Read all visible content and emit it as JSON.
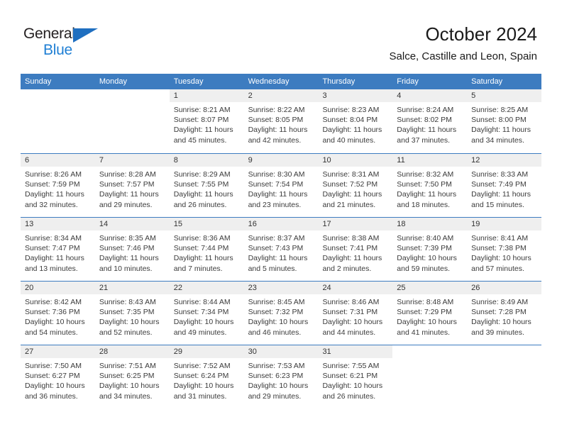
{
  "brand": {
    "name_top": "General",
    "name_bottom": "Blue",
    "color_dark": "#231f20",
    "color_blue": "#1f7fd4"
  },
  "header": {
    "title": "October 2024",
    "subtitle": "Salce, Castille and Leon, Spain"
  },
  "theme": {
    "header_row_bg": "#3d7cc0",
    "daynum_band_bg": "#efefef",
    "text": "#3b3b3b"
  },
  "calendar": {
    "weekdays": [
      "Sunday",
      "Monday",
      "Tuesday",
      "Wednesday",
      "Thursday",
      "Friday",
      "Saturday"
    ],
    "weeks": [
      [
        {
          "day": "",
          "sunrise": "",
          "sunset": "",
          "daylight": ""
        },
        {
          "day": "",
          "sunrise": "",
          "sunset": "",
          "daylight": ""
        },
        {
          "day": "1",
          "sunrise": "Sunrise: 8:21 AM",
          "sunset": "Sunset: 8:07 PM",
          "daylight": "Daylight: 11 hours and 45 minutes."
        },
        {
          "day": "2",
          "sunrise": "Sunrise: 8:22 AM",
          "sunset": "Sunset: 8:05 PM",
          "daylight": "Daylight: 11 hours and 42 minutes."
        },
        {
          "day": "3",
          "sunrise": "Sunrise: 8:23 AM",
          "sunset": "Sunset: 8:04 PM",
          "daylight": "Daylight: 11 hours and 40 minutes."
        },
        {
          "day": "4",
          "sunrise": "Sunrise: 8:24 AM",
          "sunset": "Sunset: 8:02 PM",
          "daylight": "Daylight: 11 hours and 37 minutes."
        },
        {
          "day": "5",
          "sunrise": "Sunrise: 8:25 AM",
          "sunset": "Sunset: 8:00 PM",
          "daylight": "Daylight: 11 hours and 34 minutes."
        }
      ],
      [
        {
          "day": "6",
          "sunrise": "Sunrise: 8:26 AM",
          "sunset": "Sunset: 7:59 PM",
          "daylight": "Daylight: 11 hours and 32 minutes."
        },
        {
          "day": "7",
          "sunrise": "Sunrise: 8:28 AM",
          "sunset": "Sunset: 7:57 PM",
          "daylight": "Daylight: 11 hours and 29 minutes."
        },
        {
          "day": "8",
          "sunrise": "Sunrise: 8:29 AM",
          "sunset": "Sunset: 7:55 PM",
          "daylight": "Daylight: 11 hours and 26 minutes."
        },
        {
          "day": "9",
          "sunrise": "Sunrise: 8:30 AM",
          "sunset": "Sunset: 7:54 PM",
          "daylight": "Daylight: 11 hours and 23 minutes."
        },
        {
          "day": "10",
          "sunrise": "Sunrise: 8:31 AM",
          "sunset": "Sunset: 7:52 PM",
          "daylight": "Daylight: 11 hours and 21 minutes."
        },
        {
          "day": "11",
          "sunrise": "Sunrise: 8:32 AM",
          "sunset": "Sunset: 7:50 PM",
          "daylight": "Daylight: 11 hours and 18 minutes."
        },
        {
          "day": "12",
          "sunrise": "Sunrise: 8:33 AM",
          "sunset": "Sunset: 7:49 PM",
          "daylight": "Daylight: 11 hours and 15 minutes."
        }
      ],
      [
        {
          "day": "13",
          "sunrise": "Sunrise: 8:34 AM",
          "sunset": "Sunset: 7:47 PM",
          "daylight": "Daylight: 11 hours and 13 minutes."
        },
        {
          "day": "14",
          "sunrise": "Sunrise: 8:35 AM",
          "sunset": "Sunset: 7:46 PM",
          "daylight": "Daylight: 11 hours and 10 minutes."
        },
        {
          "day": "15",
          "sunrise": "Sunrise: 8:36 AM",
          "sunset": "Sunset: 7:44 PM",
          "daylight": "Daylight: 11 hours and 7 minutes."
        },
        {
          "day": "16",
          "sunrise": "Sunrise: 8:37 AM",
          "sunset": "Sunset: 7:43 PM",
          "daylight": "Daylight: 11 hours and 5 minutes."
        },
        {
          "day": "17",
          "sunrise": "Sunrise: 8:38 AM",
          "sunset": "Sunset: 7:41 PM",
          "daylight": "Daylight: 11 hours and 2 minutes."
        },
        {
          "day": "18",
          "sunrise": "Sunrise: 8:40 AM",
          "sunset": "Sunset: 7:39 PM",
          "daylight": "Daylight: 10 hours and 59 minutes."
        },
        {
          "day": "19",
          "sunrise": "Sunrise: 8:41 AM",
          "sunset": "Sunset: 7:38 PM",
          "daylight": "Daylight: 10 hours and 57 minutes."
        }
      ],
      [
        {
          "day": "20",
          "sunrise": "Sunrise: 8:42 AM",
          "sunset": "Sunset: 7:36 PM",
          "daylight": "Daylight: 10 hours and 54 minutes."
        },
        {
          "day": "21",
          "sunrise": "Sunrise: 8:43 AM",
          "sunset": "Sunset: 7:35 PM",
          "daylight": "Daylight: 10 hours and 52 minutes."
        },
        {
          "day": "22",
          "sunrise": "Sunrise: 8:44 AM",
          "sunset": "Sunset: 7:34 PM",
          "daylight": "Daylight: 10 hours and 49 minutes."
        },
        {
          "day": "23",
          "sunrise": "Sunrise: 8:45 AM",
          "sunset": "Sunset: 7:32 PM",
          "daylight": "Daylight: 10 hours and 46 minutes."
        },
        {
          "day": "24",
          "sunrise": "Sunrise: 8:46 AM",
          "sunset": "Sunset: 7:31 PM",
          "daylight": "Daylight: 10 hours and 44 minutes."
        },
        {
          "day": "25",
          "sunrise": "Sunrise: 8:48 AM",
          "sunset": "Sunset: 7:29 PM",
          "daylight": "Daylight: 10 hours and 41 minutes."
        },
        {
          "day": "26",
          "sunrise": "Sunrise: 8:49 AM",
          "sunset": "Sunset: 7:28 PM",
          "daylight": "Daylight: 10 hours and 39 minutes."
        }
      ],
      [
        {
          "day": "27",
          "sunrise": "Sunrise: 7:50 AM",
          "sunset": "Sunset: 6:27 PM",
          "daylight": "Daylight: 10 hours and 36 minutes."
        },
        {
          "day": "28",
          "sunrise": "Sunrise: 7:51 AM",
          "sunset": "Sunset: 6:25 PM",
          "daylight": "Daylight: 10 hours and 34 minutes."
        },
        {
          "day": "29",
          "sunrise": "Sunrise: 7:52 AM",
          "sunset": "Sunset: 6:24 PM",
          "daylight": "Daylight: 10 hours and 31 minutes."
        },
        {
          "day": "30",
          "sunrise": "Sunrise: 7:53 AM",
          "sunset": "Sunset: 6:23 PM",
          "daylight": "Daylight: 10 hours and 29 minutes."
        },
        {
          "day": "31",
          "sunrise": "Sunrise: 7:55 AM",
          "sunset": "Sunset: 6:21 PM",
          "daylight": "Daylight: 10 hours and 26 minutes."
        },
        {
          "day": "",
          "sunrise": "",
          "sunset": "",
          "daylight": ""
        },
        {
          "day": "",
          "sunrise": "",
          "sunset": "",
          "daylight": ""
        }
      ]
    ]
  }
}
